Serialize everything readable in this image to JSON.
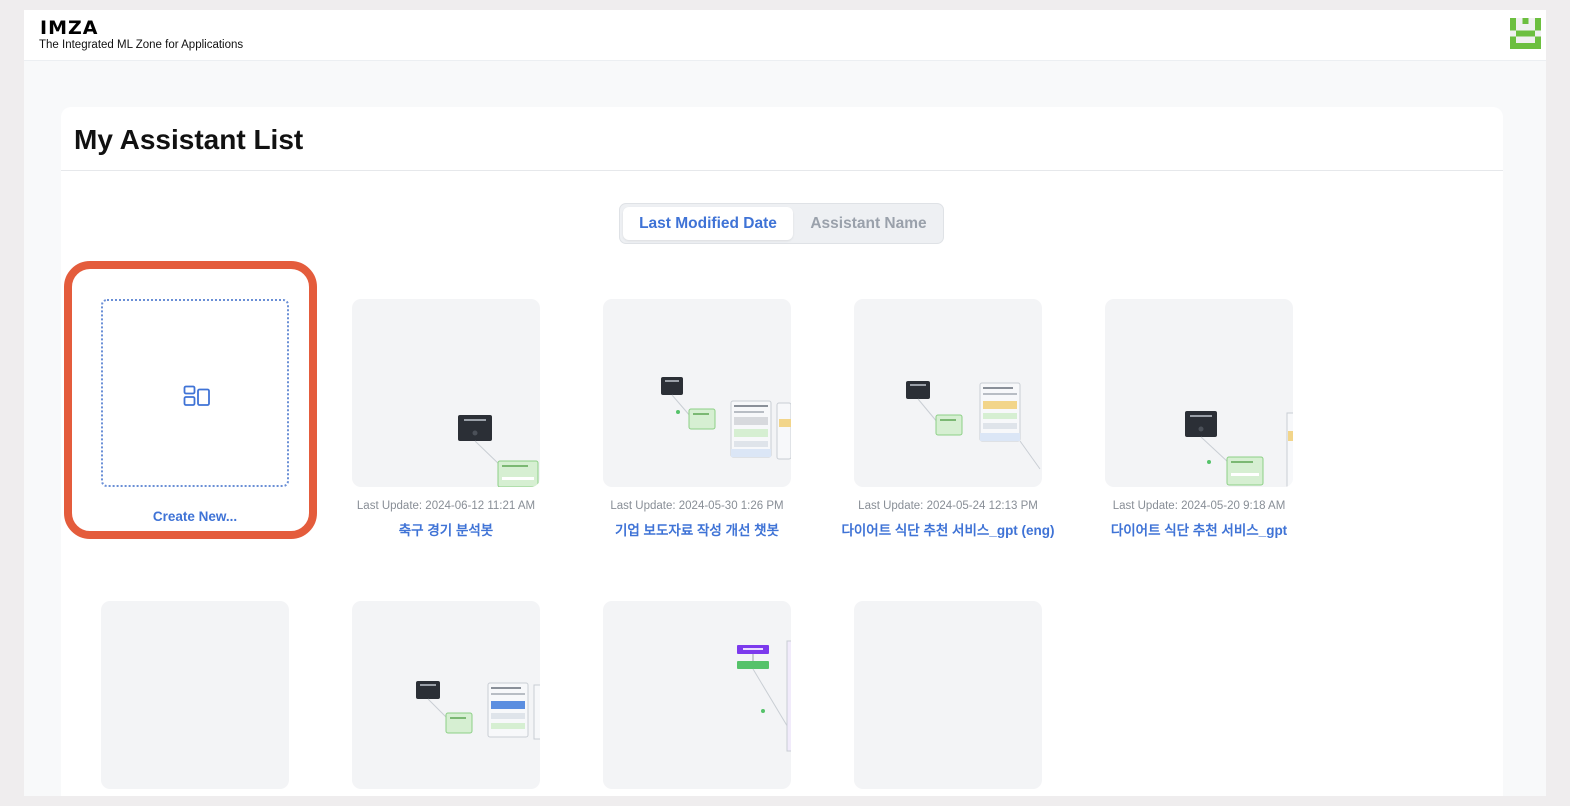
{
  "brand": {
    "title": "IMZA",
    "subtitle": "The Integrated ML Zone for Applications"
  },
  "user": {
    "avatar_icon": "identicon-avatar",
    "avatar_color": "#6cbf3f"
  },
  "page": {
    "title": "My Assistant List"
  },
  "sort": {
    "options": [
      "Last Modified Date",
      "Assistant Name"
    ],
    "selected": "Last Modified Date"
  },
  "create_new": {
    "label": "Create New...",
    "icon": "layout-icon",
    "highlight_color": "#e45c3c"
  },
  "assistants": [
    {
      "updated": "Last Update: 2024-06-12 11:21 AM",
      "name": "축구 경기 분석봇"
    },
    {
      "updated": "Last Update: 2024-05-30 1:26 PM",
      "name": "기업 보도자료 작성 개선 챗봇"
    },
    {
      "updated": "Last Update: 2024-05-24 12:13 PM",
      "name": "다이어트 식단 추천 서비스_gpt (eng)"
    },
    {
      "updated": "Last Update: 2024-05-20 9:18 AM",
      "name": "다이어트 식단 추천 서비스_gpt"
    }
  ],
  "colors": {
    "accent": "#3f73d6",
    "muted_text": "#888e96",
    "thumb_bg": "#f3f4f6"
  }
}
